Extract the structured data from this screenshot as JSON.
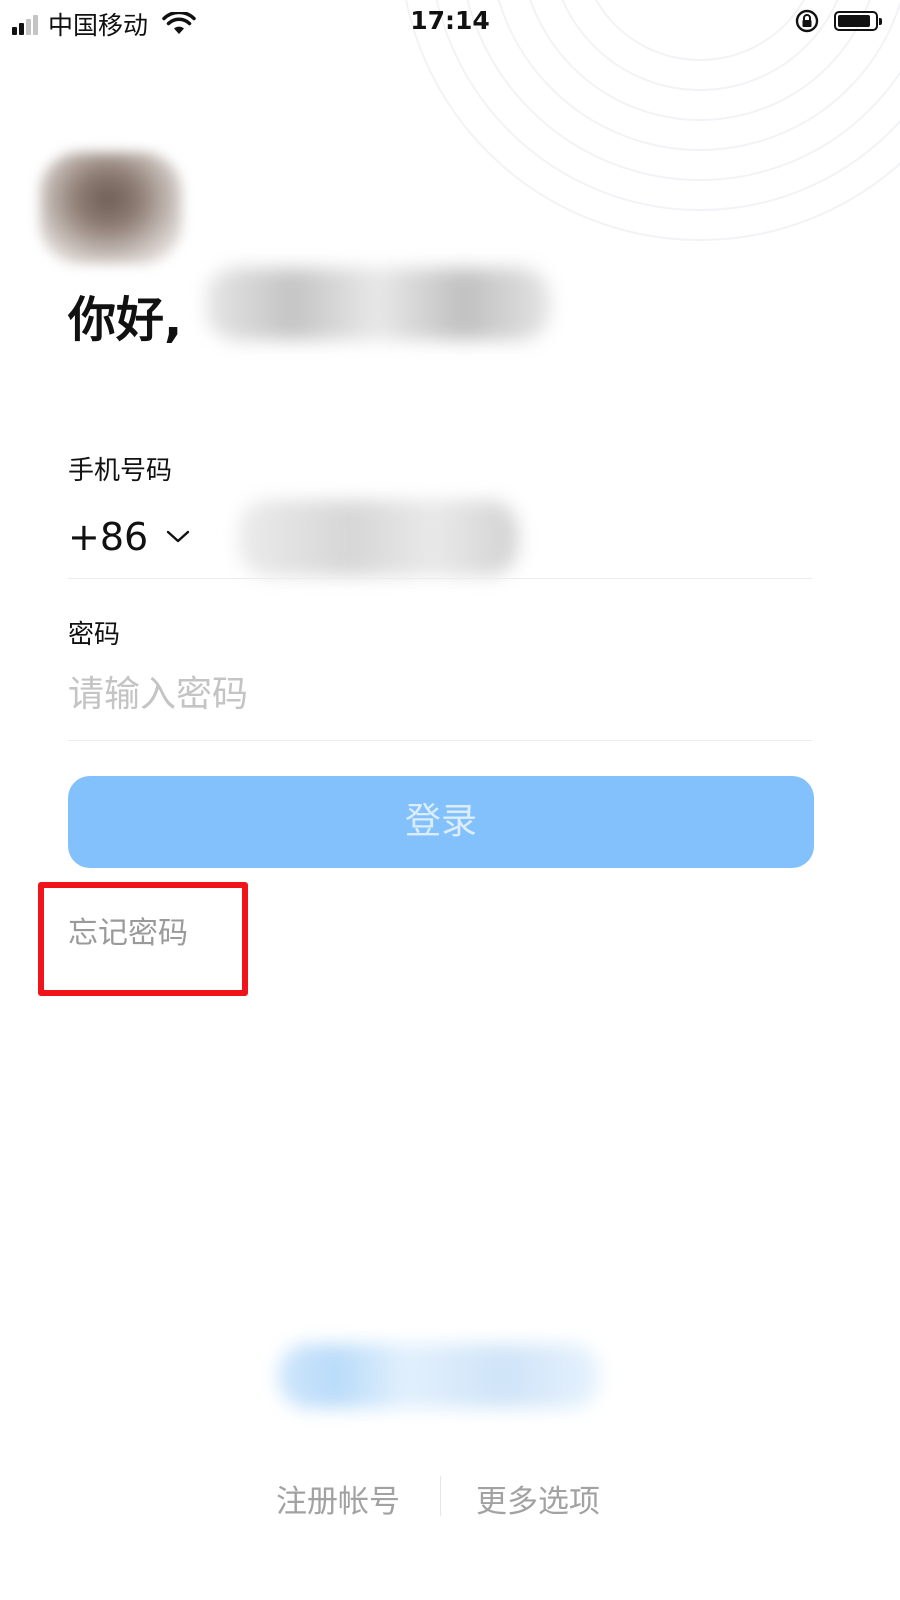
{
  "status_bar": {
    "carrier": "中国移动",
    "time": "17:14",
    "signal_bars": 4,
    "signal_active": 2
  },
  "greeting": {
    "text": "你好,"
  },
  "phone": {
    "label": "手机号码",
    "country_code": "+86"
  },
  "password": {
    "label": "密码",
    "placeholder": "请输入密码",
    "value": ""
  },
  "login_button": {
    "label": "登录"
  },
  "forgot_password": {
    "label": "忘记密码"
  },
  "footer": {
    "register": "注册帐号",
    "more_options": "更多选项"
  },
  "colors": {
    "login_button": "#82c1fb",
    "highlight_box": "#f0141a",
    "link_gray": "#9a9a9a"
  }
}
